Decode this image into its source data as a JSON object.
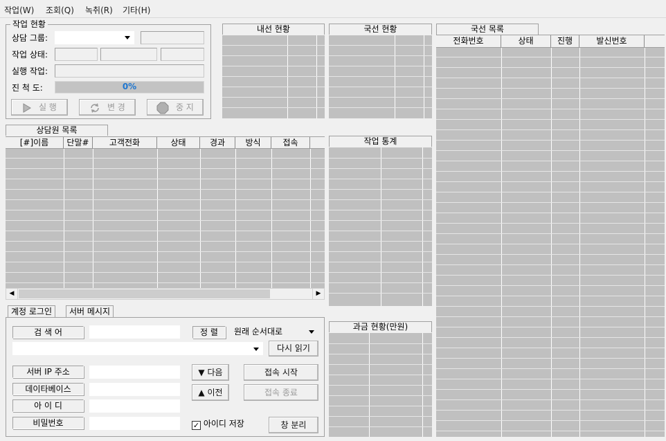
{
  "menu": [
    "작업(W)",
    "조회(Q)",
    "녹취(R)",
    "기타(H)"
  ],
  "work_status": {
    "title": "작업 현황",
    "group_label": "상담 그룹:",
    "group_value": "",
    "state_label": "작업 상태:",
    "exec_label": "실행 작업:",
    "progress_label": "진 척 도:",
    "progress_text": "0%",
    "progress_value": 0,
    "buttons": {
      "run": "실 행",
      "change": "변 경",
      "stop": "중 지"
    },
    "stop_icon_text": "STOP"
  },
  "panels": {
    "inbound": "내선 현황",
    "trunk": "국선 현황",
    "trunk_list": "국선 목록",
    "agent_list": "상담원 목록",
    "work_stats": "작업 통계",
    "billing": "과금 현황(만원)"
  },
  "trunk_list_columns": [
    "전화번호",
    "상태",
    "진행",
    "발신번호"
  ],
  "agent_columns": [
    "[#]이름",
    "단말#",
    "고객전화",
    "상태",
    "경과",
    "방식",
    "접속"
  ],
  "tabs": [
    "계정 로그인",
    "서버 메시지"
  ],
  "login": {
    "search_label": "검 색 어",
    "search_value": "",
    "sort_label": "정 렬",
    "sort_value": "원래 순서대로",
    "reload_button": "다시 읽기",
    "combo_value": "",
    "server_ip_label": "서버 IP 주소",
    "db_label": "데이타베이스",
    "id_label": "아 이 디",
    "pw_label": "비밀번호",
    "next_button": "다음",
    "prev_button": "이전",
    "connect_button": "접속 시작",
    "disconnect_button": "접속 종료",
    "save_id_label": "아이디 저장",
    "save_id_checked": true,
    "detach_button": "창 분리"
  }
}
